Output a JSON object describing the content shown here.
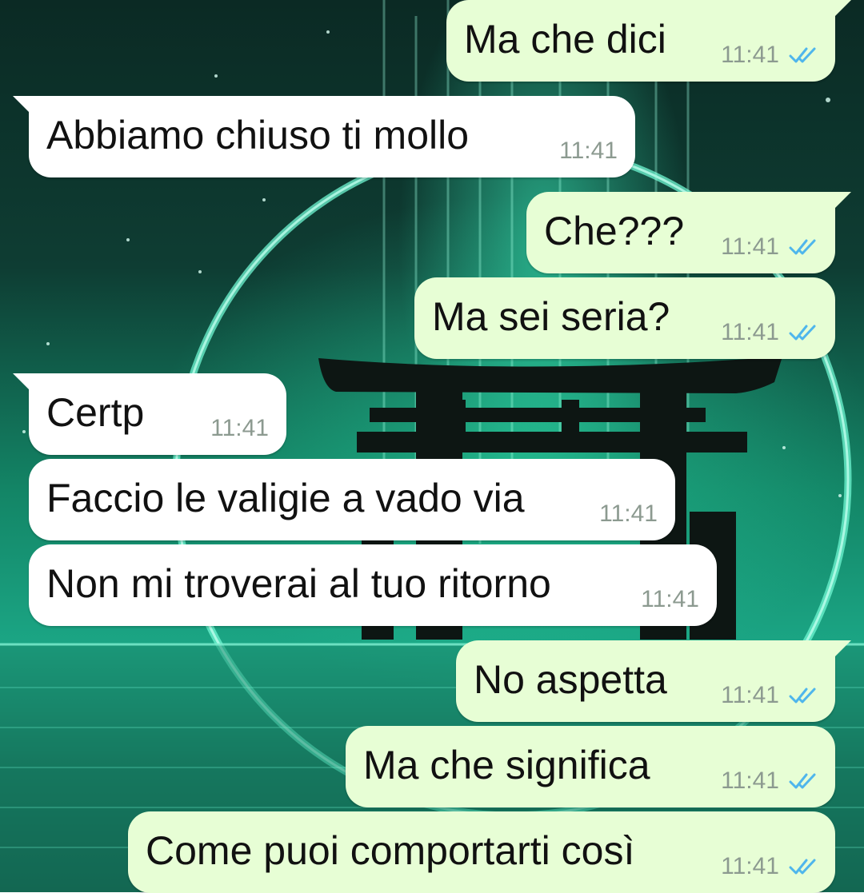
{
  "conversation": {
    "messages": [
      {
        "text": "Ma che dici",
        "time": "11:41",
        "direction": "out",
        "status": "read"
      },
      {
        "text": "Abbiamo chiuso ti mollo",
        "time": "11:41",
        "direction": "in"
      },
      {
        "text": "Che???",
        "time": "11:41",
        "direction": "out",
        "status": "read"
      },
      {
        "text": "Ma sei seria?",
        "time": "11:41",
        "direction": "out",
        "status": "read"
      },
      {
        "text": "Certp",
        "time": "11:41",
        "direction": "in"
      },
      {
        "text": "Faccio le valigie a vado via",
        "time": "11:41",
        "direction": "in"
      },
      {
        "text": "Non mi troverai al tuo ritorno",
        "time": "11:41",
        "direction": "in"
      },
      {
        "text": "No aspetta",
        "time": "11:41",
        "direction": "out",
        "status": "read"
      },
      {
        "text": "Ma che significa",
        "time": "11:41",
        "direction": "out",
        "status": "read"
      },
      {
        "text": "Come puoi comportarti così",
        "time": "11:41",
        "direction": "out",
        "status": "read"
      }
    ]
  },
  "colors": {
    "outgoing_bubble": "#e7fed5",
    "incoming_bubble": "#ffffff",
    "read_ticks": "#4fb6ec",
    "timestamp": "#8c9a90",
    "wallpaper_accent": "#2fe3b0"
  },
  "icons": {
    "read_receipt": "double-check-icon",
    "wallpaper": "torii-gate-wallpaper"
  }
}
